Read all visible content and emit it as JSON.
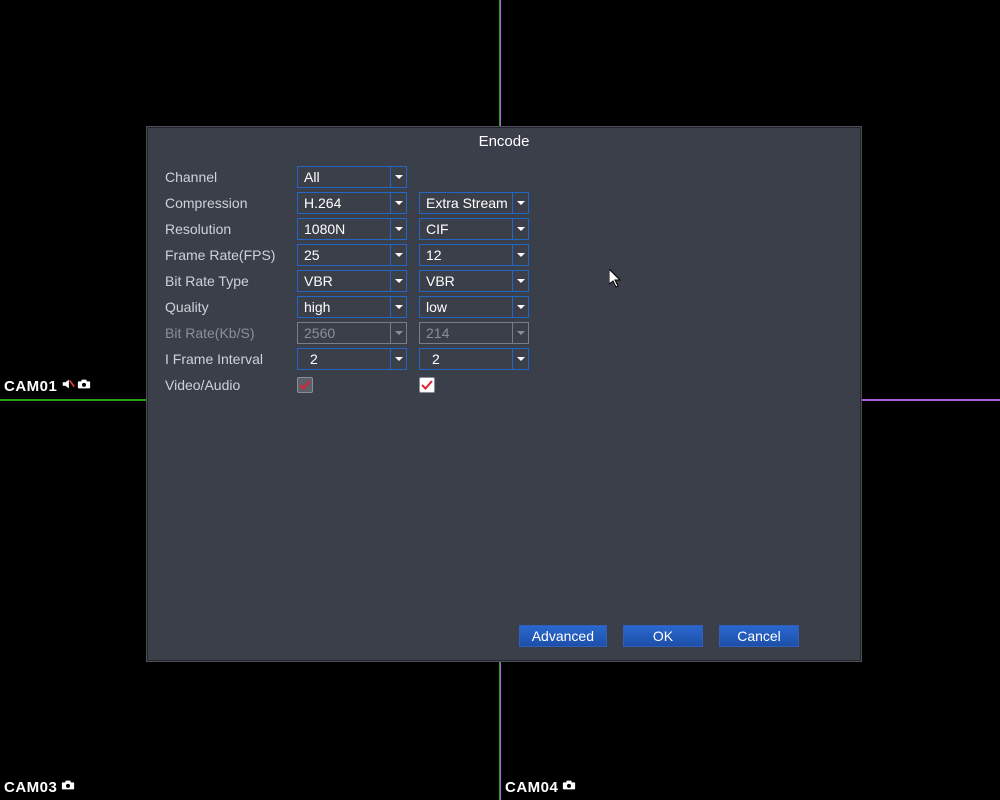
{
  "cameras": {
    "tl": "CAM01",
    "tr": "",
    "bl": "CAM03",
    "br": "CAM04"
  },
  "dialog": {
    "title": "Encode",
    "labels": {
      "channel": "Channel",
      "compression": "Compression",
      "resolution": "Resolution",
      "fps": "Frame Rate(FPS)",
      "bitrateType": "Bit Rate Type",
      "quality": "Quality",
      "bitrate": "Bit Rate(Kb/S)",
      "iframe": "I Frame Interval",
      "va": "Video/Audio"
    },
    "values": {
      "channel": "All",
      "compression_main": "H.264",
      "compression_sub": "Extra Stream",
      "resolution_main": "1080N",
      "resolution_sub": "CIF",
      "fps_main": "25",
      "fps_sub": "12",
      "bitrateType_main": "VBR",
      "bitrateType_sub": "VBR",
      "quality_main": "high",
      "quality_sub": "low",
      "bitrate_main": "2560",
      "bitrate_sub": "214",
      "iframe_main": "2",
      "iframe_sub": "2"
    },
    "buttons": {
      "advanced": "Advanced",
      "ok": "OK",
      "cancel": "Cancel"
    }
  }
}
